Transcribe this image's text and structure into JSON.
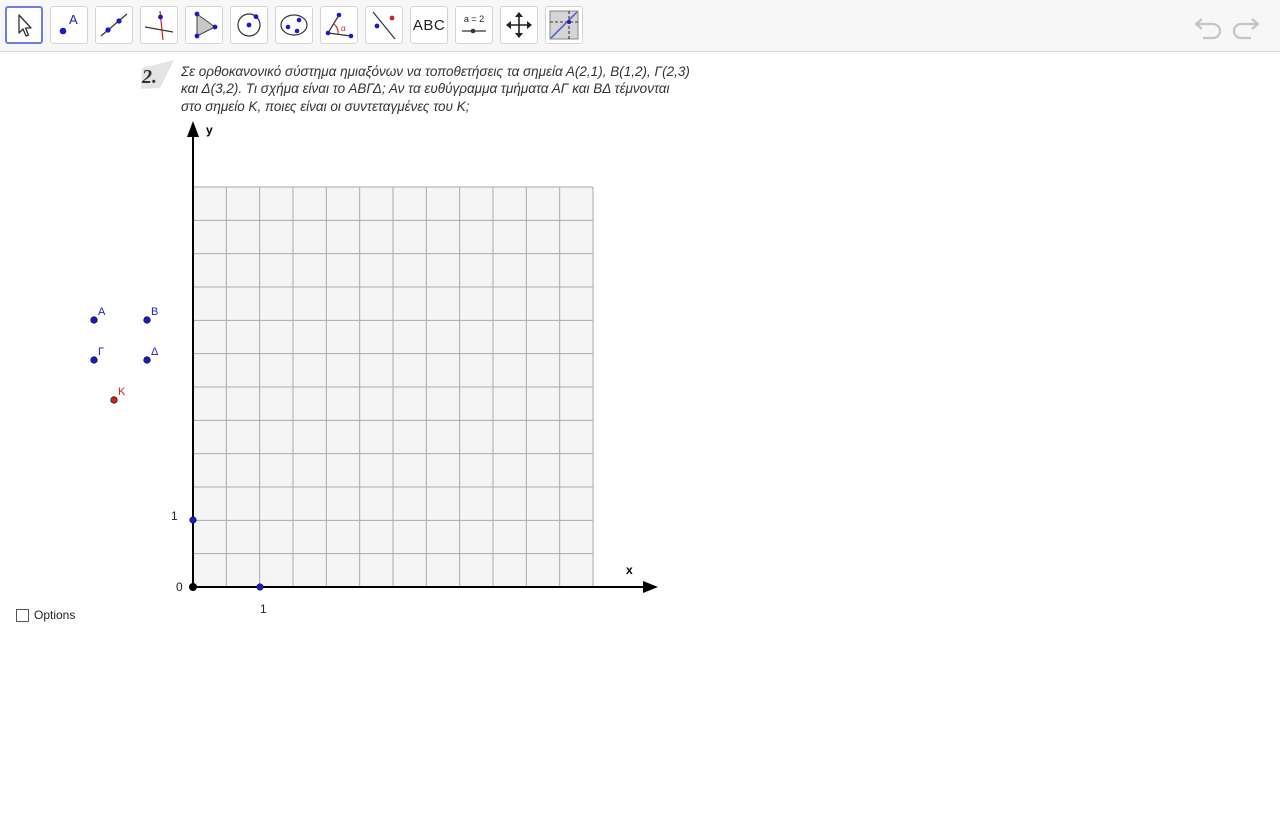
{
  "toolbar": {
    "tools": [
      {
        "name": "move-tool",
        "icon": "cursor-arrow-icon",
        "selected": true
      },
      {
        "name": "point-tool",
        "icon": "point-icon",
        "label": "A"
      },
      {
        "name": "line-tool",
        "icon": "line-icon"
      },
      {
        "name": "perpendicular-line-tool",
        "icon": "perpendicular-line-icon"
      },
      {
        "name": "polygon-tool",
        "icon": "polygon-icon"
      },
      {
        "name": "circle-tool",
        "icon": "circle-center-point-icon"
      },
      {
        "name": "conic-tool",
        "icon": "ellipse-icon"
      },
      {
        "name": "angle-tool",
        "icon": "angle-icon",
        "label": "α"
      },
      {
        "name": "reflect-tool",
        "icon": "reflect-about-line-icon"
      },
      {
        "name": "text-tool",
        "icon": "text-icon",
        "label": "ABC"
      },
      {
        "name": "slider-tool",
        "icon": "slider-icon",
        "label": "a = 2"
      },
      {
        "name": "move-graphics-view-tool",
        "icon": "move-arrows-icon"
      },
      {
        "name": "show-hide-tool",
        "icon": "show-hide-object-icon"
      }
    ],
    "undo_icon": "undo-icon",
    "redo_icon": "redo-icon"
  },
  "exercise": {
    "number": "2.",
    "lines": [
      "Σε ορθοκανονικό σύστημα ημιαξόνων να τοποθετήσεις τα σημεία Α(2,1), Β(1,2), Γ(2,3)",
      "και Δ(3,2). Τι σχήμα είναι το ΑΒΓΔ; Αν τα ευθύγραμμα τμήματα ΑΓ και ΒΔ τέμνονται",
      "στο σημείο Κ, ποιες είναι οι συντεταγμένες του Κ;"
    ]
  },
  "graph": {
    "x_axis_label": "x",
    "y_axis_label": "y",
    "origin_label": "0",
    "x_tick_label": "1",
    "y_tick_label": "1",
    "grid_columns": 12,
    "grid_rows": 12
  },
  "points": [
    {
      "label": "Α",
      "color": "#1a1acc"
    },
    {
      "label": "Β",
      "color": "#1a1acc"
    },
    {
      "label": "Γ",
      "color": "#1a1acc"
    },
    {
      "label": "Δ",
      "color": "#1a1acc"
    },
    {
      "label": "Κ",
      "color": "#cc2222"
    }
  ],
  "options": {
    "label": "Options",
    "checked": false
  },
  "colors": {
    "accent": "#6c7ee0",
    "point_blue": "#1a1acc",
    "point_red": "#cc2222",
    "grid_fill": "#f5f5f5",
    "grid_line": "#aaaaaa"
  }
}
